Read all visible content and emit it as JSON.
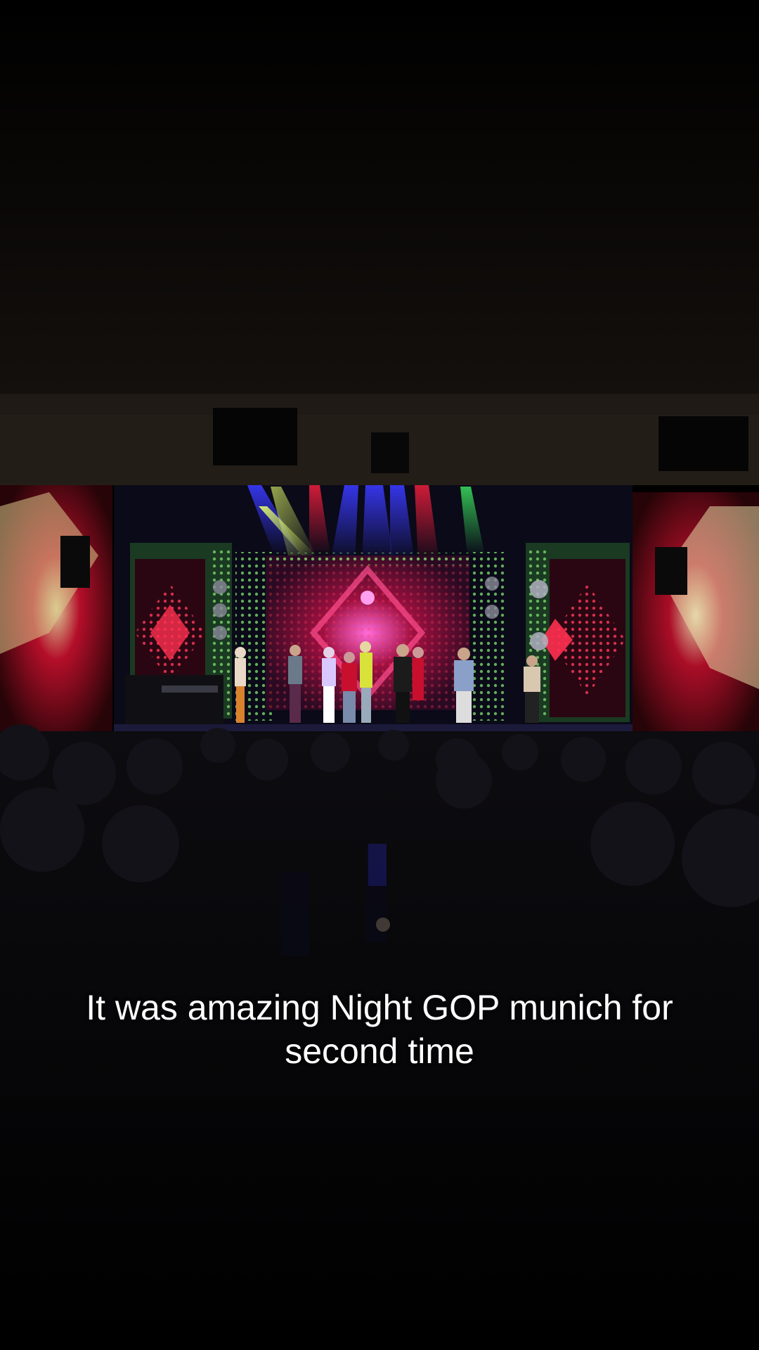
{
  "video": {
    "caption_lines": [
      "It was amazing Night GOP munich for",
      "second time"
    ]
  },
  "colors": {
    "background": "#000000",
    "stage_red": "#c8102e",
    "stage_green": "#2fa84f",
    "stage_blue": "#2a2aff",
    "stage_magenta": "#ff2bd6",
    "caption_text": "#ffffff"
  }
}
